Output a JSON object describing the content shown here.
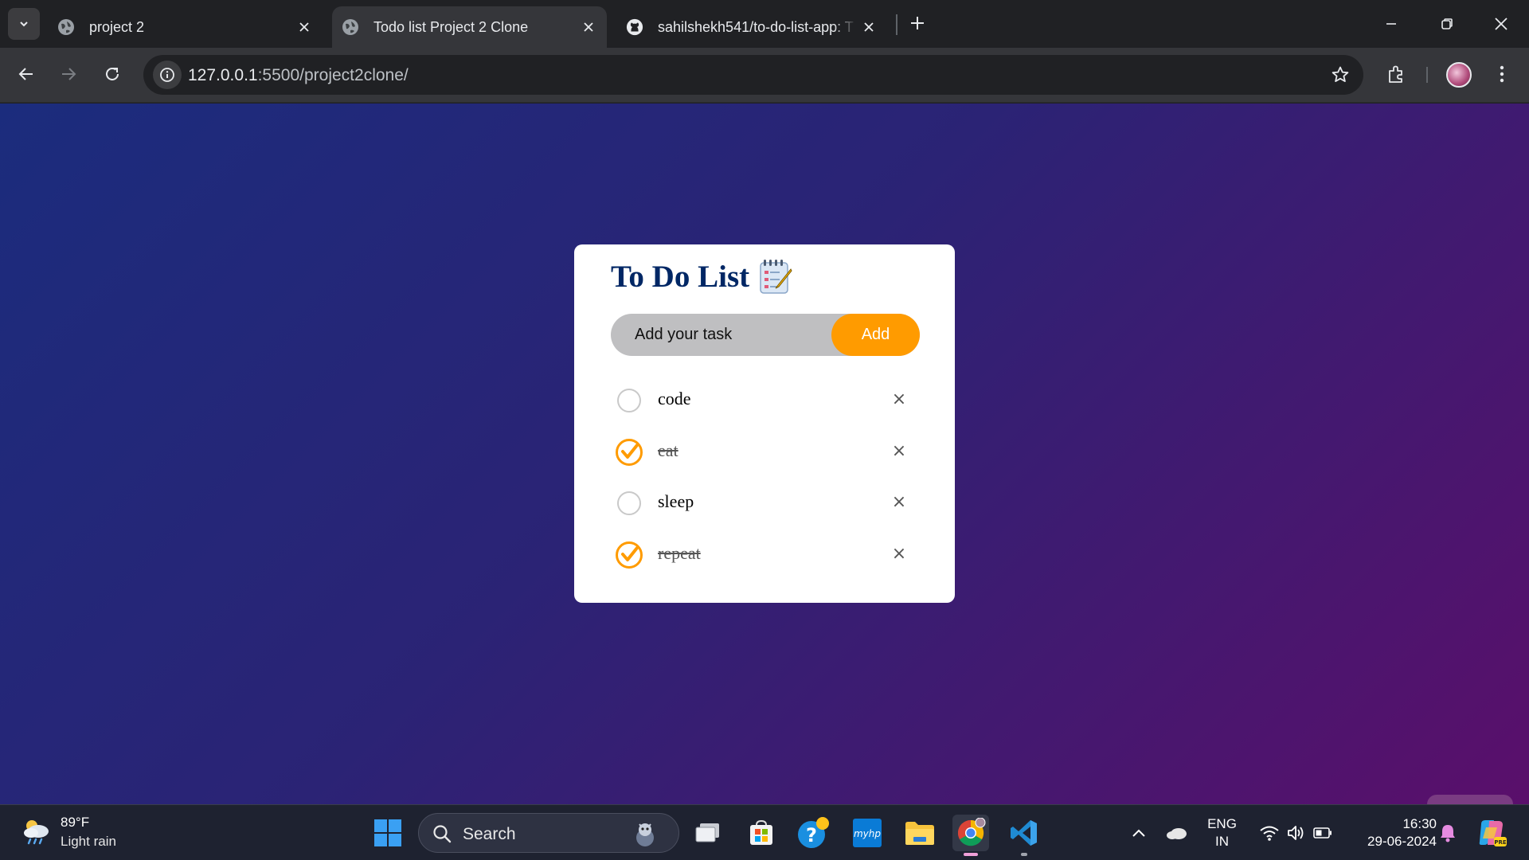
{
  "browser": {
    "tabs": [
      {
        "title": "project 2",
        "active": false
      },
      {
        "title": "Todo list Project 2 Clone",
        "active": true
      },
      {
        "title": "sahilshekh541/to-do-list-app: T",
        "active": false
      }
    ],
    "url_host": "127.0.0.1",
    "url_path": ":5500/project2clone/"
  },
  "app": {
    "title": "To Do List",
    "input_placeholder": "Add your task",
    "add_label": "Add",
    "tasks": [
      {
        "text": "code",
        "done": false
      },
      {
        "text": "eat",
        "done": true
      },
      {
        "text": "sleep",
        "done": false
      },
      {
        "text": "repeat",
        "done": true
      }
    ],
    "delete_glyph": "×"
  },
  "taskbar": {
    "weather_temp": "89°F",
    "weather_desc": "Light rain",
    "search_label": "Search",
    "lang_line1": "ENG",
    "lang_line2": "IN",
    "time": "16:30",
    "date": "29-06-2024"
  },
  "colors": {
    "accent": "#ff9b00",
    "title": "#002765",
    "bg_start": "#1b2c7d",
    "bg_end": "#5a0f6b"
  }
}
